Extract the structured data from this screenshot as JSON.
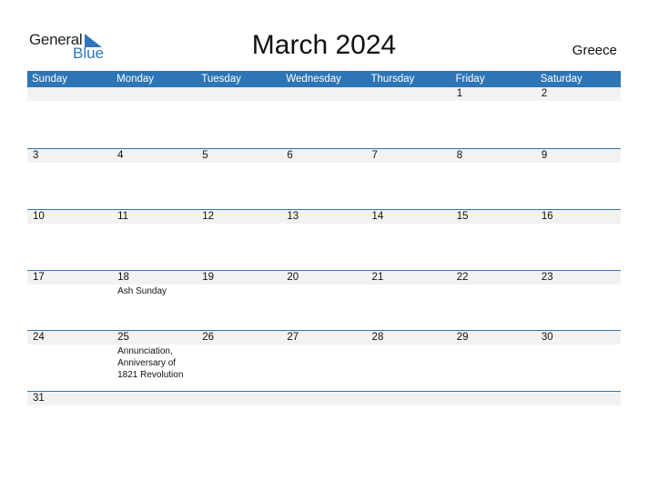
{
  "brand": {
    "general": "General",
    "blue": "Blue",
    "accent": "#2e75b6"
  },
  "title": "March 2024",
  "country": "Greece",
  "weekdays": [
    "Sunday",
    "Monday",
    "Tuesday",
    "Wednesday",
    "Thursday",
    "Friday",
    "Saturday"
  ],
  "weeks": [
    [
      {
        "d": ""
      },
      {
        "d": ""
      },
      {
        "d": ""
      },
      {
        "d": ""
      },
      {
        "d": ""
      },
      {
        "d": "1"
      },
      {
        "d": "2"
      }
    ],
    [
      {
        "d": "3"
      },
      {
        "d": "4"
      },
      {
        "d": "5"
      },
      {
        "d": "6"
      },
      {
        "d": "7"
      },
      {
        "d": "8"
      },
      {
        "d": "9"
      }
    ],
    [
      {
        "d": "10"
      },
      {
        "d": "11"
      },
      {
        "d": "12"
      },
      {
        "d": "13"
      },
      {
        "d": "14"
      },
      {
        "d": "15"
      },
      {
        "d": "16"
      }
    ],
    [
      {
        "d": "17"
      },
      {
        "d": "18",
        "h": "Ash Sunday"
      },
      {
        "d": "19"
      },
      {
        "d": "20"
      },
      {
        "d": "21"
      },
      {
        "d": "22"
      },
      {
        "d": "23"
      }
    ],
    [
      {
        "d": "24"
      },
      {
        "d": "25",
        "h": "Annunciation, Anniversary of 1821 Revolution"
      },
      {
        "d": "26"
      },
      {
        "d": "27"
      },
      {
        "d": "28"
      },
      {
        "d": "29"
      },
      {
        "d": "30"
      }
    ],
    [
      {
        "d": "31"
      },
      {
        "d": ""
      },
      {
        "d": ""
      },
      {
        "d": ""
      },
      {
        "d": ""
      },
      {
        "d": ""
      },
      {
        "d": ""
      }
    ]
  ]
}
